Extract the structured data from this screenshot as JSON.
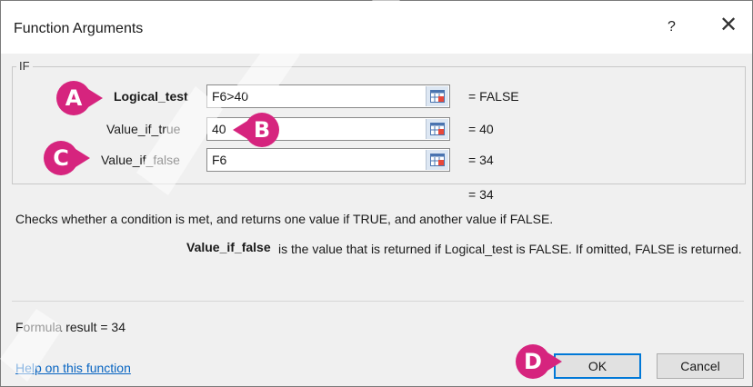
{
  "dialog": {
    "title": "Function Arguments",
    "help_glyph": "?",
    "close_glyph": "✕"
  },
  "group": {
    "label": "IF",
    "args": [
      {
        "label": "Logical_test",
        "value": "F6>40",
        "result": "=  FALSE",
        "bold": true
      },
      {
        "label": "Value_if_true",
        "value": "40",
        "result": "=  40",
        "bold": false
      },
      {
        "label": "Value_if_false",
        "value": "F6",
        "result": "=  34",
        "bold": false
      }
    ],
    "overall_result": "=  34"
  },
  "description": "Checks whether a condition is met, and returns one value if TRUE, and another value if FALSE.",
  "arg_help": {
    "name": "Value_if_false",
    "text": "is the value that is returned if Logical_test is FALSE. If omitted, FALSE is returned."
  },
  "formula_result": "Formula result =   34",
  "help_link": "Help on this function",
  "buttons": {
    "ok": "OK",
    "cancel": "Cancel"
  },
  "callouts": {
    "a": "A",
    "b": "B",
    "c": "C",
    "d": "D"
  },
  "colors": {
    "callout": "#d6247e",
    "link": "#0563c1",
    "ok_border": "#0078d7"
  }
}
